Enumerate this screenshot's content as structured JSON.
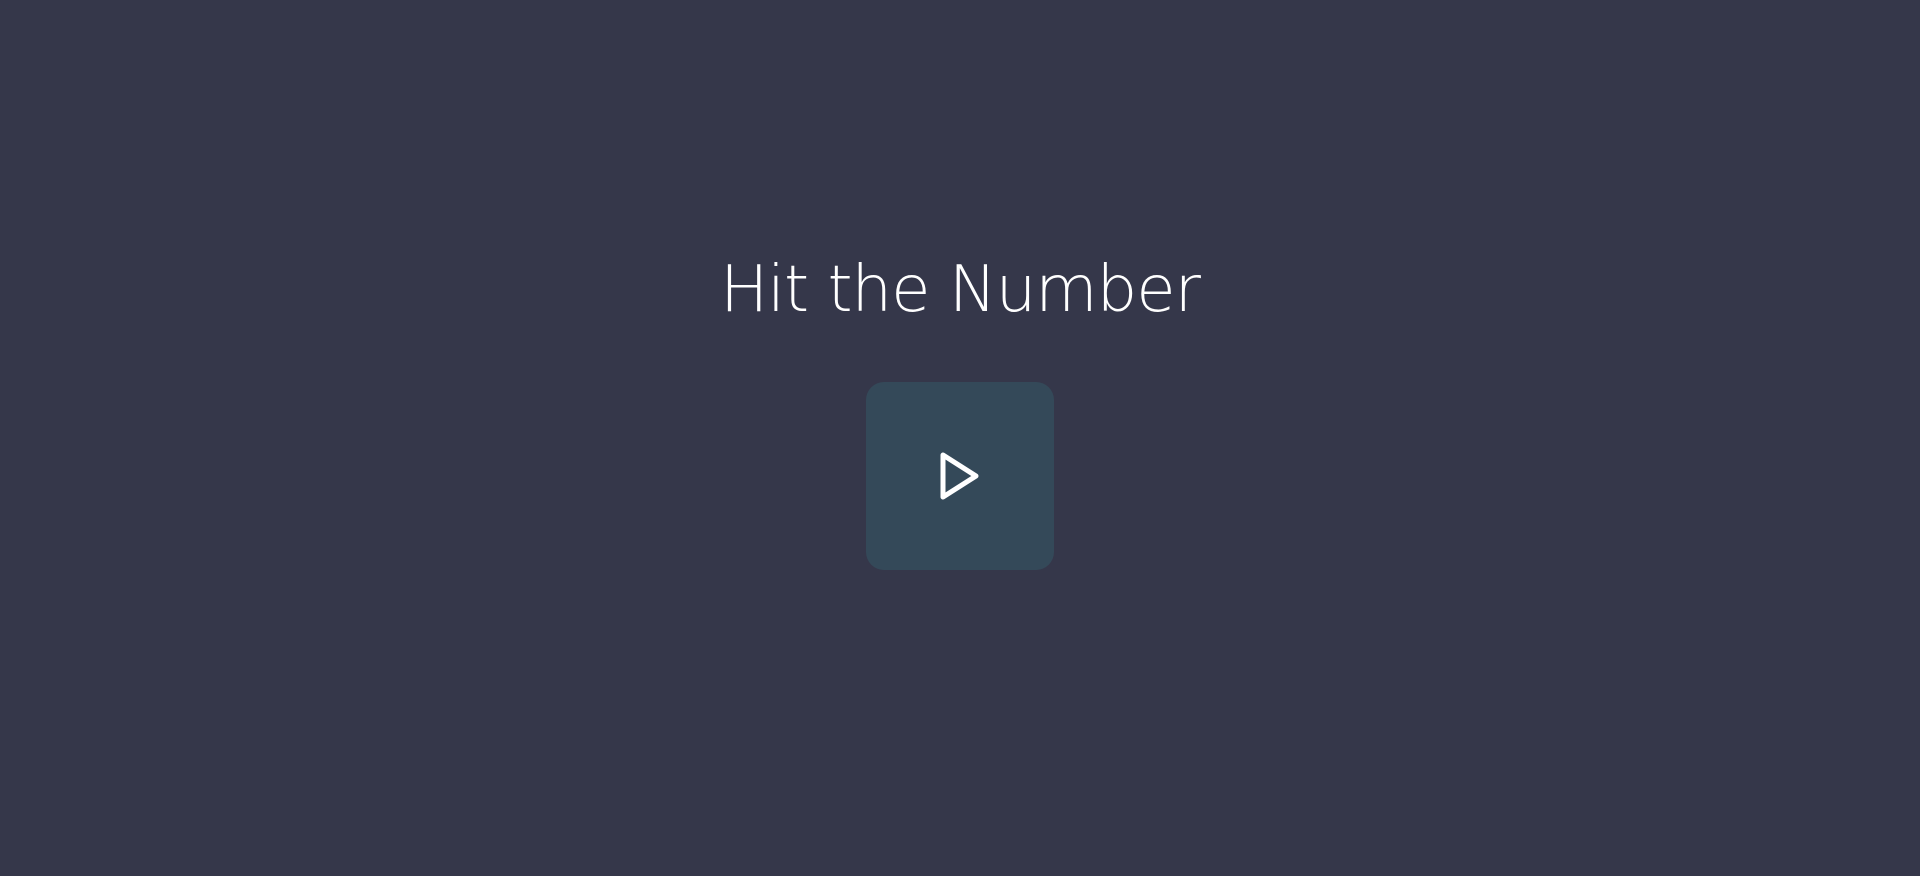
{
  "game": {
    "title": "Hit the Number"
  },
  "play_button": {
    "icon": "play-icon"
  },
  "colors": {
    "background": "#35374a",
    "button_background": "#344959",
    "foreground": "#ffffff"
  }
}
